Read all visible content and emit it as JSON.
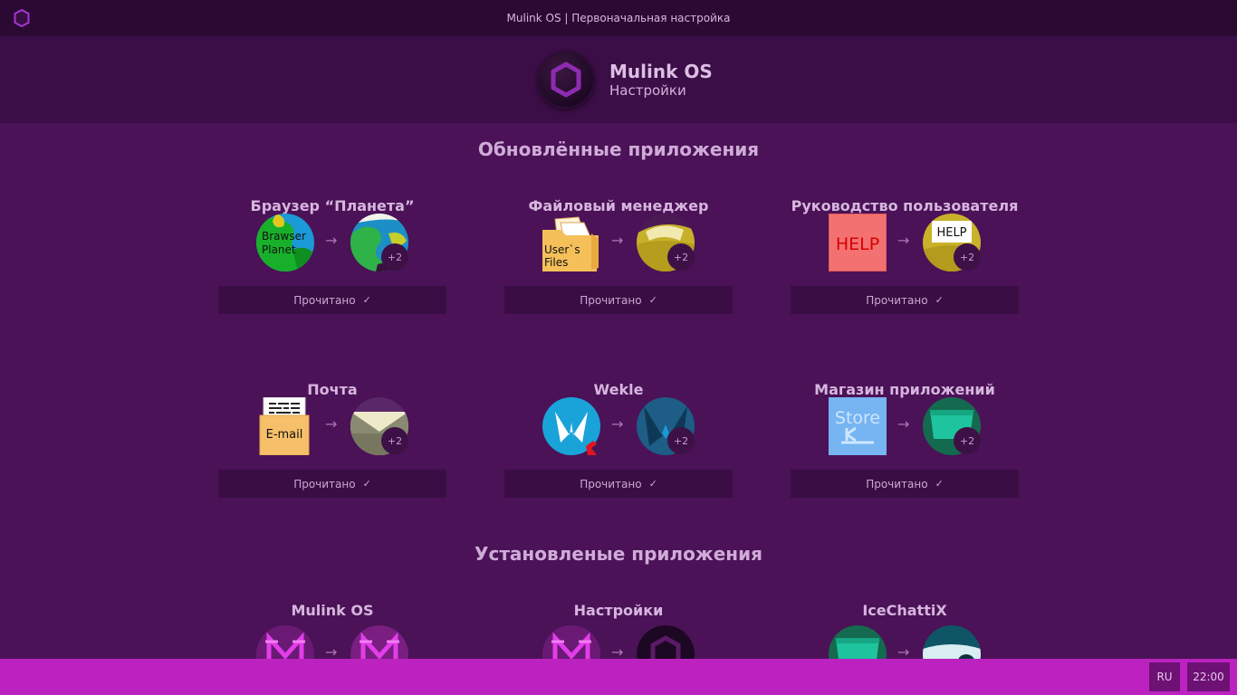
{
  "window": {
    "title": "Mulink OS | Первоначальная настройка"
  },
  "header": {
    "app_name": "Mulink OS",
    "subtitle": "Настройки"
  },
  "sections": {
    "updated_title": "Обновлённые приложения",
    "installed_title": "Установленые приложения"
  },
  "updated_apps": [
    {
      "name": "Браузер “Планета”",
      "old_icon_text": [
        "Brawser",
        "Planet"
      ],
      "icon": "planet-browser-icon",
      "badge": "+2",
      "read_label": "Прочитано"
    },
    {
      "name": "Файловый менеджер",
      "old_icon_text": [
        "User`s",
        "Files"
      ],
      "icon": "file-manager-icon",
      "badge": "+2",
      "read_label": "Прочитано"
    },
    {
      "name": "Руководство пользователя",
      "old_icon_text": [
        "HELP"
      ],
      "new_icon_text": "HELP",
      "icon": "user-guide-icon",
      "badge": "+2",
      "read_label": "Прочитано"
    },
    {
      "name": "Почта",
      "old_icon_text": [
        "E-mail"
      ],
      "icon": "mail-icon",
      "badge": "+2",
      "read_label": "Прочитано"
    },
    {
      "name": "Wekle",
      "icon": "wekle-icon",
      "badge": "+2",
      "read_label": "Прочитано"
    },
    {
      "name": "Магазин приложений",
      "old_icon_text": [
        "Store"
      ],
      "icon": "app-store-icon",
      "badge": "+2",
      "read_label": "Прочитано"
    }
  ],
  "installed_apps": [
    {
      "name": "Mulink OS",
      "icon": "mulink-os-icon"
    },
    {
      "name": "Настройки",
      "icon": "settings-icon"
    },
    {
      "name": "IceChattiX",
      "icon": "icechattix-icon"
    }
  ],
  "taskbar": {
    "language": "RU",
    "clock": "22:00"
  },
  "colors": {
    "background": "#4b1257",
    "titlebar": "#2a0a33",
    "header": "#3c0e47",
    "button": "#3a0e44",
    "taskbar": "#bb22c0",
    "accent": "#8e2bb0"
  }
}
